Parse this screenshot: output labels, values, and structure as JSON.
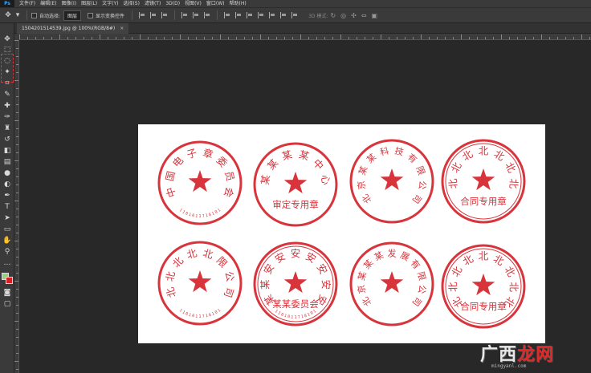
{
  "app": {
    "logo": "Ps"
  },
  "menu": [
    "文件(F)",
    "编辑(E)",
    "图像(I)",
    "图层(L)",
    "文字(Y)",
    "选择(S)",
    "滤镜(T)",
    "3D(D)",
    "视图(V)",
    "窗口(W)",
    "帮助(H)"
  ],
  "options": {
    "auto_select_label": "自动选择:",
    "auto_select_value": "图层",
    "transform_controls_label": "显示变换控件",
    "mode_3d_label": "3D 模式:"
  },
  "document": {
    "tab_title": "1504201514539.jpg @ 100%(RGB/8#)",
    "close_glyph": "×"
  },
  "colors": {
    "foreground": "#93d17f",
    "background": "#d81f26",
    "seal_red": "#d8343c",
    "brand_red": "#e02a2a"
  },
  "seals": [
    {
      "top": "中国电子章委员会",
      "bottom": "",
      "serial": "1101011718101",
      "style": "single-ring"
    },
    {
      "top": "某某某某中心",
      "bottom": "审定专用章",
      "serial": "",
      "style": "single-ring"
    },
    {
      "top": "北京某某科技有限公司",
      "bottom": "",
      "serial": "",
      "style": "single-ring"
    },
    {
      "top": "北北北北北北北",
      "bottom": "合同专用章",
      "serial": "",
      "style": "double-ring"
    },
    {
      "top": "北北北北北限公司",
      "bottom": "",
      "serial": "1101011718101",
      "style": "single-ring"
    },
    {
      "top": "某某安安安安安安安",
      "bottom": "某某委员会",
      "serial": "1101011718101",
      "style": "double-ring"
    },
    {
      "top": "北京某某某发展有限公司",
      "bottom": "",
      "serial": "",
      "style": "single-ring"
    },
    {
      "top": "北北北北北北北北北",
      "bottom": "合同专用章",
      "serial": "",
      "style": "double-ring"
    }
  ],
  "watermark": {
    "logo_black": "广西",
    "logo_red": "龙网",
    "url": "mingyanl.com"
  }
}
